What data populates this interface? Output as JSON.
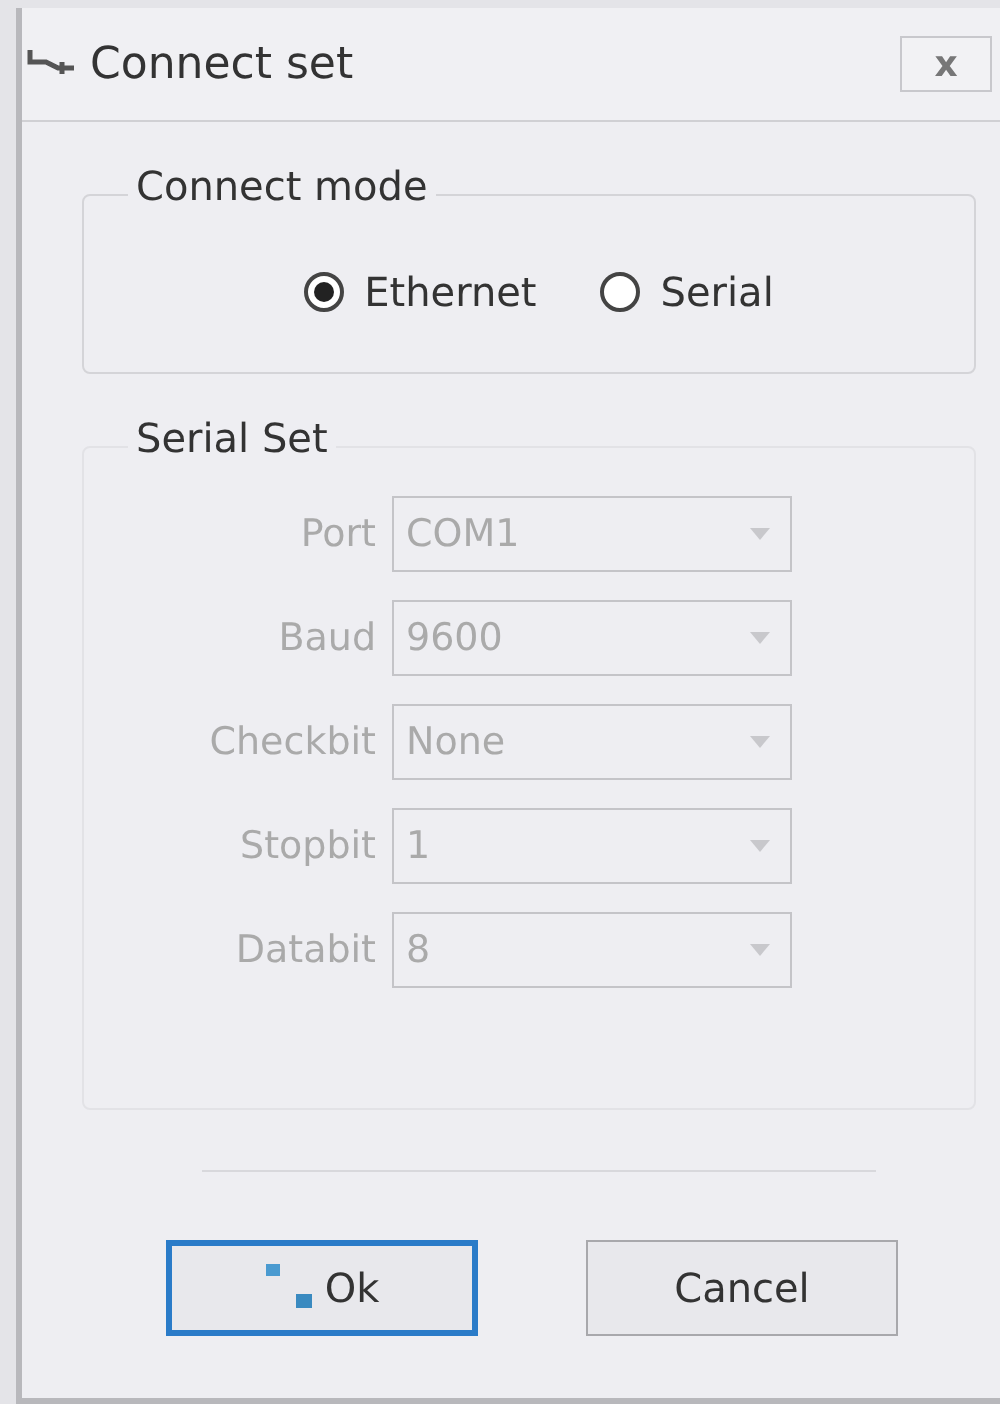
{
  "window": {
    "title": "Connect set",
    "close": "x"
  },
  "connect_mode": {
    "title": "Connect mode",
    "options": [
      {
        "label": "Ethernet",
        "selected": true
      },
      {
        "label": "Serial",
        "selected": false
      }
    ]
  },
  "serial_set": {
    "title": "Serial Set",
    "disabled": true,
    "fields": [
      {
        "label": "Port",
        "value": "COM1"
      },
      {
        "label": "Baud",
        "value": "9600"
      },
      {
        "label": "Checkbit",
        "value": "None"
      },
      {
        "label": "Stopbit",
        "value": "1"
      },
      {
        "label": "Databit",
        "value": "8"
      }
    ]
  },
  "buttons": [
    {
      "label": "Ok",
      "focused": true,
      "kind": "ok"
    },
    {
      "label": "Cancel",
      "focused": false,
      "kind": "plain"
    }
  ]
}
